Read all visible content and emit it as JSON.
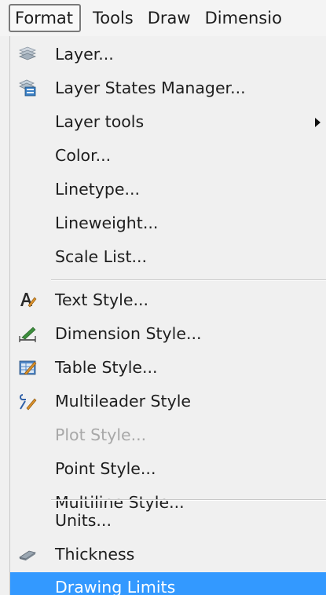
{
  "menubar": {
    "items": [
      "Format",
      "Tools",
      "Draw",
      "Dimensio"
    ],
    "active_index": 0
  },
  "menu": {
    "group1": [
      {
        "label": "Layer...",
        "icon": "layer-stack-icon"
      },
      {
        "label": "Layer States Manager...",
        "icon": "layer-states-icon"
      },
      {
        "label": "Layer tools",
        "submenu": true
      },
      {
        "label": "Color..."
      },
      {
        "label": "Linetype..."
      },
      {
        "label": "Lineweight..."
      },
      {
        "label": "Scale List..."
      }
    ],
    "group2": [
      {
        "label": "Text Style...",
        "icon": "text-style-icon"
      },
      {
        "label": "Dimension Style...",
        "icon": "dimension-style-icon"
      },
      {
        "label": "Table Style...",
        "icon": "table-style-icon"
      },
      {
        "label": "Multileader Style",
        "icon": "multileader-icon"
      },
      {
        "label": "Plot Style...",
        "disabled": true
      },
      {
        "label": "Point Style..."
      },
      {
        "label": "Multiline Style..."
      }
    ],
    "group3": [
      {
        "label": "Units..."
      },
      {
        "label": "Thickness",
        "icon": "thickness-icon"
      },
      {
        "label": "Drawing Limits",
        "highlighted": true
      }
    ]
  },
  "colors": {
    "highlight": "#3399ff",
    "disabled_text": "#a8a8a8"
  }
}
